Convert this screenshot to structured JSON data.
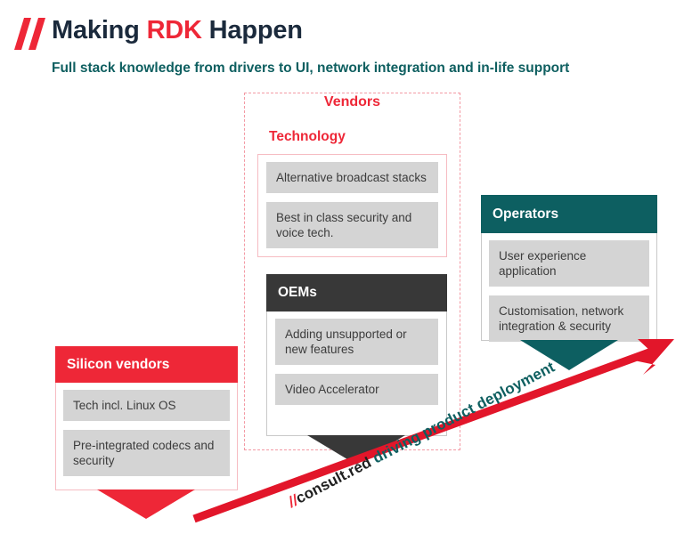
{
  "header": {
    "logo_icon": "double-slash-logo",
    "title_part1": "Making ",
    "title_highlight": "RDK",
    "title_part2": " Happen",
    "subtitle": "Full stack knowledge from drivers to UI, network integration and in-life support"
  },
  "diagram": {
    "vendors_group_label": "Vendors",
    "pillars": [
      {
        "id": "silicon-vendors",
        "title": "Silicon vendors",
        "header_bg": "#ee2737",
        "header_text_color": "#ffffff",
        "arrow_color": "#ee2737",
        "items": [
          "Tech incl. Linux OS",
          "Pre-integrated codecs and security"
        ]
      },
      {
        "id": "technology",
        "title": "Technology",
        "header_bg": "#ffffff",
        "header_text_color": "#ee2737",
        "arrow_color": "none",
        "items": [
          "Alternative broadcast stacks",
          "Best in class security and voice tech."
        ]
      },
      {
        "id": "oems",
        "title": "OEMs",
        "header_bg": "#383838",
        "header_text_color": "#ffffff",
        "arrow_color": "#383838",
        "items": [
          "Adding unsupported or new features",
          "Video Accelerator"
        ]
      },
      {
        "id": "operators",
        "title": "Operators",
        "header_bg": "#0d5f61",
        "header_text_color": "#ffffff",
        "arrow_color": "#0d5f61",
        "items": [
          "User experience application",
          "Customisation, network integration & security"
        ]
      }
    ]
  },
  "callout": {
    "arrow_icon": "diagonal-arrow-up-right",
    "arrow_color": "#e2162a",
    "caption_slash": "//",
    "caption_brand": "consult.red",
    "caption_tail": " driving product deployment"
  },
  "colors": {
    "brand_red": "#ee2737",
    "brand_teal": "#0d5f61",
    "dark_navy": "#1b2a3c",
    "charcoal": "#383838",
    "chip_gray": "#d4d4d4",
    "dashed_pink": "#f39aa4"
  }
}
